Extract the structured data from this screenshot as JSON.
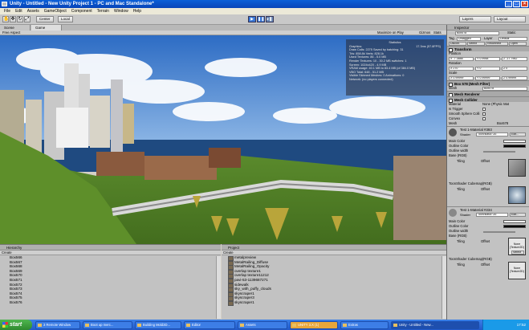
{
  "window": {
    "title": "Unity - Untitled - New Unity Project 1 - PC and Mac Standalone*"
  },
  "menu": [
    "File",
    "Edit",
    "Assets",
    "GameObject",
    "Component",
    "Terrain",
    "Window",
    "Help"
  ],
  "toolbar": {
    "pivot_label": "Center",
    "space_label": "Local",
    "layers_label": "Layers",
    "layout_label": "Layout"
  },
  "view_tabs": [
    "Scene",
    "Game"
  ],
  "game_bar": {
    "aspect": "Free Aspect",
    "maximize": "Maximize on Play",
    "gizmos": "Gizmos",
    "stats": "Stats"
  },
  "stats": {
    "title": "Statistics",
    "section": "Graphics:",
    "fps": "17.3ms (57.8FPS)",
    "lines": [
      "Draw Calls: 2275   Saved by batching: 31",
      "Tris: 858.8k   Verts: 828.1k",
      "Used Textures: 86 - 5.0 MB",
      "Render Textures: 10 - 30.2 MB  switches: 1",
      "Screen: 1024x420 - 4.9 MB",
      "VRAM usage: 40.1 MB to 83.4 MB (of 384.0 MB)",
      "VBO Total: 648 - 51.2 MB",
      "Visible Skinned Meshes: 0   Animations: 0",
      "Network: (no players connected)"
    ]
  },
  "hierarchy": {
    "title": "Hierarchy",
    "create": "Create",
    "items": [
      "Box566",
      "Box567",
      "Box568",
      "Box569",
      "Box570",
      "Box571",
      "Box572",
      "Box573",
      "Box574",
      "Box575",
      "Box576"
    ]
  },
  "project": {
    "title": "Project",
    "create": "Create",
    "items": [
      "metalpreview",
      "MetalRailing_Diffuse",
      "MetalRailing_Opacity",
      "overlap texture1",
      "overlap texture11212",
      "pavi-53-1139687271",
      "sidewalk",
      "sky_with_puffy_clouds",
      "skyscraper1",
      "skyscraper3",
      "skyscraper1"
    ]
  },
  "inspector": {
    "title": "Inspector",
    "object_name": "Box578",
    "static_label": "Static",
    "tag_label": "Tag",
    "tag_value": "Untagged",
    "layer_label": "Layer",
    "layer_value": "Default",
    "prefab_buttons": [
      "Discon.",
      "Select",
      "Reconnect",
      "Open"
    ],
    "transform": {
      "title": "Transform",
      "position_label": "Position",
      "position": [
        "X -7.3888",
        "Y 0.9958",
        "Z -17.7962"
      ],
      "rotation_label": "Rotation",
      "rotation": [
        "X 270",
        "Y 0",
        "Z 0"
      ],
      "scale_label": "Scale",
      "scale": [
        "X 0.99999",
        "Y 0.99999",
        "Z 0.99999"
      ]
    },
    "mesh_filter": {
      "title": "Box 578 (Mesh Filter)",
      "mesh_label": "Mesh",
      "mesh_value": "Box578"
    },
    "mesh_renderer": {
      "title": "Mesh Renderer"
    },
    "mesh_collider": {
      "title": "Mesh Collider",
      "rows": [
        [
          "Material",
          "None (Physic Mat"
        ],
        [
          "Is Trigger",
          ""
        ],
        [
          "Smooth Sphere Colli",
          ""
        ],
        [
          "Convex",
          ""
        ],
        [
          "Mesh",
          "Box578"
        ]
      ]
    },
    "material1": {
      "title": "Test 1-Material #393",
      "shader_label": "Shader",
      "shader_value": "Toon/Basic Ou",
      "edit_label": "Edit...",
      "main_color": "Main Color",
      "outline_color": "Outline Color",
      "outline_width": "Outline width",
      "base_label": "Base (RGB)",
      "tiling": "Tiling",
      "offset": "Offset",
      "cubemap_label": "ToonShader Cubemap(RGB)"
    },
    "material2": {
      "title": "Test 1-Material #234",
      "shader_label": "Shader",
      "shader_value": "Toon/Basic Ou",
      "edit_label": "Edit...",
      "main_color": "Main Color",
      "outline_color": "Outline Color",
      "outline_width": "Outline width",
      "base_label": "Base (RGB)",
      "tiling": "Tiling",
      "offset": "Offset",
      "none_label": "None (Texture2D)",
      "select_label": "Select",
      "cubemap_label": "ToonShader Cubemap(RGB)"
    }
  },
  "taskbar": {
    "start": "start",
    "tasks": [
      "3 Remote Window",
      "Boot up merc...",
      "Building Mold3D...",
      "Editor",
      "Assets",
      "UNITY 3.X (1)",
      "Extras",
      "Unity - Untitled - New..."
    ],
    "clock": "17:52"
  },
  "colors": {
    "sky": "#3f7fd0",
    "sea": "#1f4a80",
    "grass": "#4f7a26"
  }
}
